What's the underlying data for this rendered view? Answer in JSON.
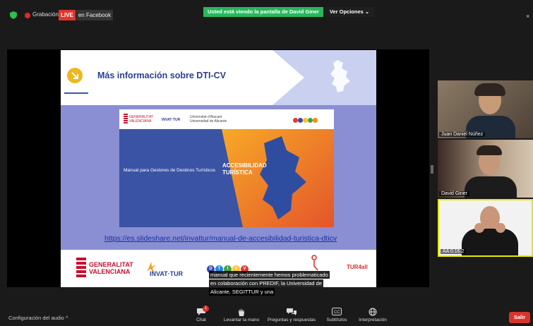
{
  "topbar": {
    "recording_label": "Grabación",
    "live_badge": "LIVE",
    "facebook_label": "en Facebook",
    "sharing_banner": "Usted está viendo la pantalla de David Giner",
    "view_options": "Ver Opciones ⌄",
    "close_glyph": "×"
  },
  "slide": {
    "title": "Más información sobre DTI-CV",
    "cover_subtitle": "Manual para Gestores de Destinos Turísticos",
    "cover_title_line1": "ACCESIBILIDAD",
    "cover_title_line2": "TURÍSTICA",
    "cover_logo_gv": "GENERALITAT VALENCIANA",
    "cover_logo_invat": "INVAT·TUR",
    "cover_logo_ua": "Universitat d'Alacant Universidad de Alicante",
    "url": "https://es.slideshare.net/invattur/manual-de-accesibilidad-turistica-dticv",
    "footer_gv_line1": "GENERALITAT",
    "footer_gv_line2": "VALENCIANA",
    "footer_invat": "INVAT·TUR",
    "footer_dti": [
      "D",
      "T",
      "I",
      "C",
      "V"
    ],
    "footer_tur": "TUR4all"
  },
  "captions": {
    "line1": "manual que recientemente hemos problematicado",
    "line2": "en colaboración con PREDIF, la Universidad de",
    "line3": "Alicante, SEGITTUR y una"
  },
  "participants": [
    {
      "name": "Juan Daniel Núñez"
    },
    {
      "name": "David Giner"
    },
    {
      "name": "AA 0.16.2"
    }
  ],
  "toolbar": {
    "audio_config": "Configuración del audio  ^",
    "chat": "Chat",
    "chat_badge": "1",
    "raise_hand": "Levantar la mano",
    "qa": "Preguntas y respuestas",
    "subtitles": "Subtítulos",
    "interpretation": "Interpretación",
    "leave": "Salir"
  },
  "colors": {
    "live_red": "#e0362b",
    "banner_green": "#27b85c",
    "leave_red": "#d9342b",
    "slide_purple": "#8a8fd4"
  }
}
